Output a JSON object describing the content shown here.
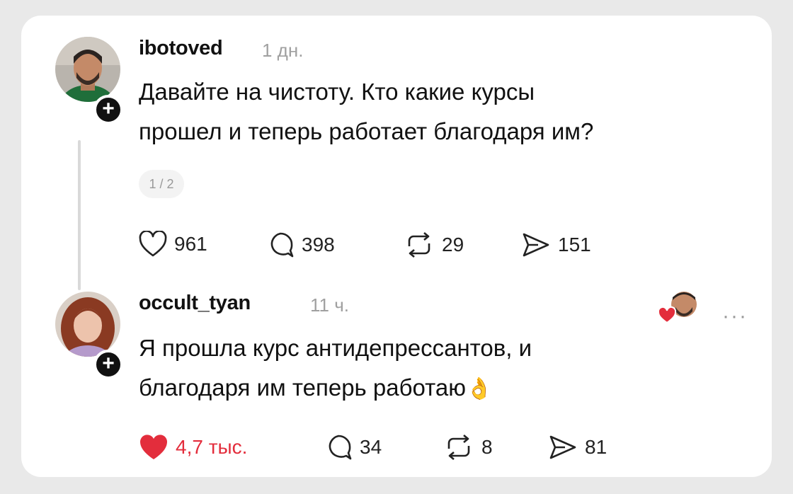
{
  "post": {
    "username": "ibotoved",
    "time": "1 дн.",
    "text_line1": "Давайте на чистоту. Кто какие курсы",
    "text_line2": "прошел и теперь работает благодаря им?",
    "pager": "1 / 2",
    "likes": "961",
    "comments": "398",
    "reposts": "29",
    "shares": "151"
  },
  "reply": {
    "username": "occult_tyan",
    "time": "11 ч.",
    "text_line1": "Я прошла курс антидепрессантов, и",
    "text_line2": "благодаря им теперь работаю",
    "emoji": "👌",
    "likes": "4,7 тыс.",
    "comments": "34",
    "reposts": "8",
    "shares": "81",
    "more": "···"
  },
  "icons": {
    "like": "heart-icon",
    "comment": "comment-icon",
    "repost": "repost-icon",
    "share": "share-icon",
    "follow": "plus-icon"
  },
  "colors": {
    "liked_red": "#e32d3c",
    "muted": "#a0a0a0"
  }
}
